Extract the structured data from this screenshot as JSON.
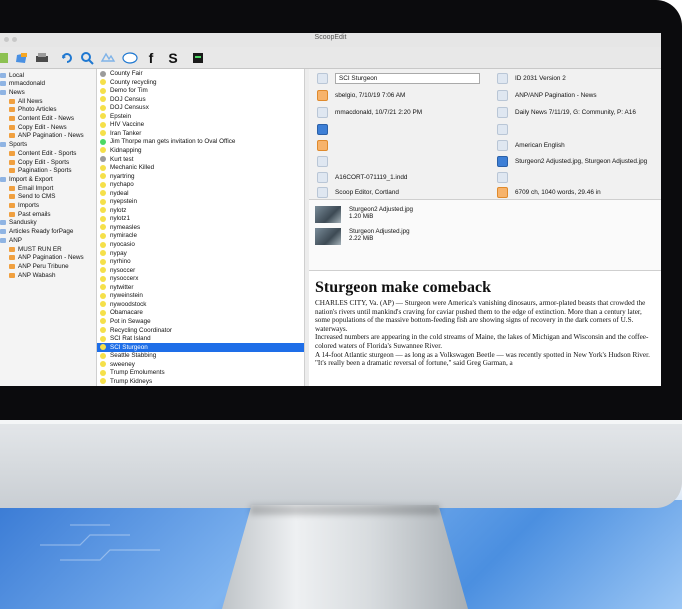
{
  "window": {
    "title": "ScoopEdit"
  },
  "toolbar": {
    "icons": [
      "new-story-icon",
      "open-icon",
      "print-icon",
      "sync-icon",
      "search-icon",
      "web-icon",
      "chat-icon",
      "facebook-icon",
      "skype-icon",
      "terminal-icon"
    ],
    "glyphs": {
      "facebook": "f",
      "skype": "S"
    }
  },
  "sidebar": {
    "items": [
      {
        "label": "Local",
        "level": 0
      },
      {
        "label": "mmacdonald",
        "level": 0
      },
      {
        "label": "News",
        "level": 0
      },
      {
        "label": "All News",
        "level": 1
      },
      {
        "label": "Photo Articles",
        "level": 1
      },
      {
        "label": "Content Edit - News",
        "level": 1
      },
      {
        "label": "Copy Edit - News",
        "level": 1
      },
      {
        "label": "ANP Pagination - News",
        "level": 1
      },
      {
        "label": "Sports",
        "level": 0
      },
      {
        "label": "Content Edit - Sports",
        "level": 1
      },
      {
        "label": "Copy Edit - Sports",
        "level": 1
      },
      {
        "label": "Pagination - Sports",
        "level": 1
      },
      {
        "label": "Import & Export",
        "level": 0
      },
      {
        "label": "Email Import",
        "level": 1
      },
      {
        "label": "Send to CMS",
        "level": 1
      },
      {
        "label": "Imports",
        "level": 1
      },
      {
        "label": "Past emails",
        "level": 1
      },
      {
        "label": "Sandusky",
        "level": 0
      },
      {
        "label": "Articles Ready forPage",
        "level": 0
      },
      {
        "label": "ANP",
        "level": 0
      },
      {
        "label": "MUST RUN ER",
        "level": 1
      },
      {
        "label": "ANP Pagination - News",
        "level": 1
      },
      {
        "label": "ANP Peru Tribune",
        "level": 1
      },
      {
        "label": "ANP Wabash",
        "level": 1
      }
    ]
  },
  "stories": {
    "items": [
      {
        "label": "County Fair",
        "status": "gray"
      },
      {
        "label": "County recycling",
        "status": "yellow"
      },
      {
        "label": "Demo for Tim",
        "status": "yellow"
      },
      {
        "label": "DOJ Census",
        "status": "yellow"
      },
      {
        "label": "DOJ Censusx",
        "status": "yellow"
      },
      {
        "label": "Epstein",
        "status": "yellow"
      },
      {
        "label": "HIV Vaccine",
        "status": "yellow"
      },
      {
        "label": "Iran Tanker",
        "status": "yellow"
      },
      {
        "label": "Jim Thorpe man gets invitation to Oval Office",
        "status": "green"
      },
      {
        "label": "Kidnapping",
        "status": "yellow"
      },
      {
        "label": "Kurt test",
        "status": "gray"
      },
      {
        "label": "Mechanic Killed",
        "status": "yellow"
      },
      {
        "label": "nyartring",
        "status": "yellow"
      },
      {
        "label": "nychapo",
        "status": "yellow"
      },
      {
        "label": "nydeal",
        "status": "yellow"
      },
      {
        "label": "nyepstein",
        "status": "yellow"
      },
      {
        "label": "nylotz",
        "status": "yellow"
      },
      {
        "label": "nylotz1",
        "status": "yellow"
      },
      {
        "label": "nymeasles",
        "status": "yellow"
      },
      {
        "label": "nymiracle",
        "status": "yellow"
      },
      {
        "label": "nyocasio",
        "status": "yellow"
      },
      {
        "label": "nypay",
        "status": "yellow"
      },
      {
        "label": "nyrhino",
        "status": "yellow"
      },
      {
        "label": "nysoccer",
        "status": "yellow"
      },
      {
        "label": "nysoccerx",
        "status": "yellow"
      },
      {
        "label": "nytwitter",
        "status": "yellow"
      },
      {
        "label": "nyweinstein",
        "status": "yellow"
      },
      {
        "label": "nywoodstock",
        "status": "yellow"
      },
      {
        "label": "Obamacare",
        "status": "yellow"
      },
      {
        "label": "Pot in Sewage",
        "status": "yellow"
      },
      {
        "label": "Recycling Coordinator",
        "status": "yellow"
      },
      {
        "label": "SCI Rat Island",
        "status": "yellow"
      },
      {
        "label": "SCI Sturgeon",
        "status": "yellow",
        "selected": true
      },
      {
        "label": "Seattle Stabbing",
        "status": "yellow"
      },
      {
        "label": "sweeney",
        "status": "yellow"
      },
      {
        "label": "Trump Emoluments",
        "status": "yellow"
      },
      {
        "label": "Trump Kidneys",
        "status": "yellow"
      }
    ]
  },
  "meta": {
    "name": "SCI Sturgeon",
    "created": "sbelgio, 7/10/19 7:06 AM",
    "modified": "mmacdonald, 10/7/21 2:20 PM",
    "file": "A16CORT-071119_1.indd",
    "desk": "Scoop Editor, Cortland",
    "id": "ID 2031 Version 2",
    "location": "ANP/ANP Pagination - News",
    "publication": "Daily News 7/11/19, G: Community, P: A16",
    "language": "American English",
    "images": "Sturgeon2 Adjusted.jpg, Sturgeon Adjusted.jpg",
    "stats": "6709 ch, 1040 words, 29.46 in"
  },
  "attachments": [
    {
      "name": "Sturgeon2 Adjusted.jpg",
      "size": "1.20 MiB"
    },
    {
      "name": "Sturgeon Adjusted.jpg",
      "size": "2.22 MiB"
    }
  ],
  "article": {
    "headline": "Sturgeon make comeback",
    "paragraphs": [
      "CHARLES CITY, Va. (AP) — Sturgeon were America's vanishing dinosaurs, armor-plated beasts that crowded the nation's rivers until mankind's craving for caviar pushed them to the edge of extinction. More than a century later, some populations of the massive bottom-feeding fish are showing signs of recovery in the dark corners of U.S. waterways.",
      "Increased numbers are appearing in the cold streams of Maine, the lakes of Michigan and Wisconsin and the coffee-colored waters of Florida's Suwannee River.",
      "A 14-foot Atlantic sturgeon — as long as a Volkswagen Beetle — was recently spotted in New York's Hudson River.",
      "\"It's really been a dramatic reversal of fortune,\" said Greg Garman, a"
    ]
  },
  "colors": {
    "selection": "#1e6ee8",
    "folder": "#f0a040",
    "highlight": "#f5e04a"
  }
}
